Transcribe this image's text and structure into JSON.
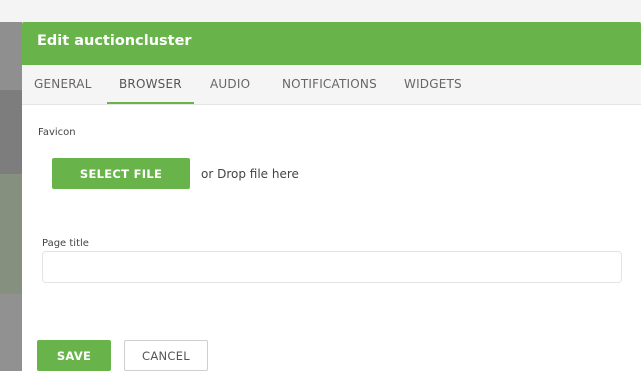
{
  "dialog": {
    "title": "Edit auctioncluster"
  },
  "tabs": [
    {
      "label": "GENERAL",
      "active": false
    },
    {
      "label": "BROWSER",
      "active": true
    },
    {
      "label": "AUDIO",
      "active": false
    },
    {
      "label": "NOTIFICATIONS",
      "active": false
    },
    {
      "label": "WIDGETS",
      "active": false
    }
  ],
  "favicon": {
    "label": "Favicon",
    "select_button": "SELECT FILE",
    "drop_text": "or Drop file here"
  },
  "page_title": {
    "label": "Page title",
    "value": "",
    "placeholder": ""
  },
  "actions": {
    "save_label": "SAVE",
    "cancel_label": "CANCEL"
  },
  "colors": {
    "accent": "#68b44a",
    "tab_bar": "#f5f5f5",
    "text": "#444444"
  }
}
